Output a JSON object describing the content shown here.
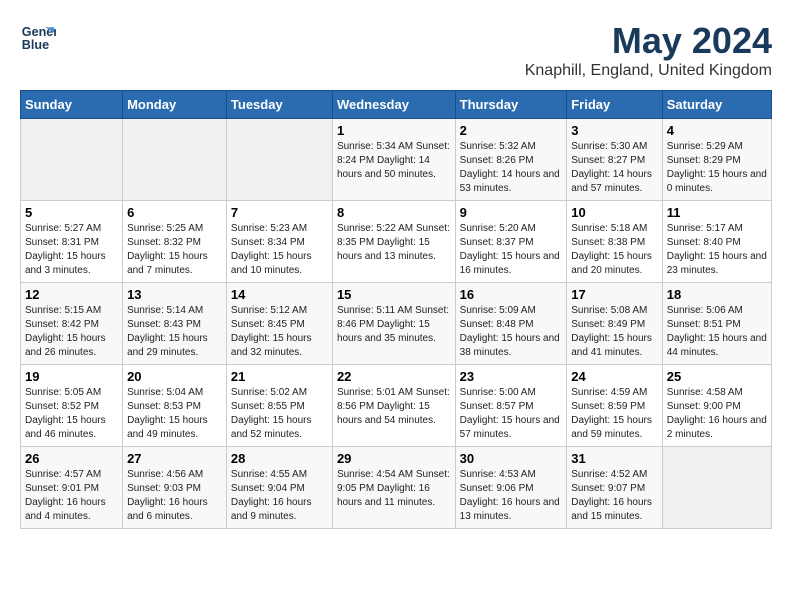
{
  "logo": {
    "line1": "General",
    "line2": "Blue"
  },
  "title": "May 2024",
  "subtitle": "Knaphill, England, United Kingdom",
  "days_header": [
    "Sunday",
    "Monday",
    "Tuesday",
    "Wednesday",
    "Thursday",
    "Friday",
    "Saturday"
  ],
  "weeks": [
    [
      {
        "day": "",
        "info": ""
      },
      {
        "day": "",
        "info": ""
      },
      {
        "day": "",
        "info": ""
      },
      {
        "day": "1",
        "info": "Sunrise: 5:34 AM\nSunset: 8:24 PM\nDaylight: 14 hours\nand 50 minutes."
      },
      {
        "day": "2",
        "info": "Sunrise: 5:32 AM\nSunset: 8:26 PM\nDaylight: 14 hours\nand 53 minutes."
      },
      {
        "day": "3",
        "info": "Sunrise: 5:30 AM\nSunset: 8:27 PM\nDaylight: 14 hours\nand 57 minutes."
      },
      {
        "day": "4",
        "info": "Sunrise: 5:29 AM\nSunset: 8:29 PM\nDaylight: 15 hours\nand 0 minutes."
      }
    ],
    [
      {
        "day": "5",
        "info": "Sunrise: 5:27 AM\nSunset: 8:31 PM\nDaylight: 15 hours\nand 3 minutes."
      },
      {
        "day": "6",
        "info": "Sunrise: 5:25 AM\nSunset: 8:32 PM\nDaylight: 15 hours\nand 7 minutes."
      },
      {
        "day": "7",
        "info": "Sunrise: 5:23 AM\nSunset: 8:34 PM\nDaylight: 15 hours\nand 10 minutes."
      },
      {
        "day": "8",
        "info": "Sunrise: 5:22 AM\nSunset: 8:35 PM\nDaylight: 15 hours\nand 13 minutes."
      },
      {
        "day": "9",
        "info": "Sunrise: 5:20 AM\nSunset: 8:37 PM\nDaylight: 15 hours\nand 16 minutes."
      },
      {
        "day": "10",
        "info": "Sunrise: 5:18 AM\nSunset: 8:38 PM\nDaylight: 15 hours\nand 20 minutes."
      },
      {
        "day": "11",
        "info": "Sunrise: 5:17 AM\nSunset: 8:40 PM\nDaylight: 15 hours\nand 23 minutes."
      }
    ],
    [
      {
        "day": "12",
        "info": "Sunrise: 5:15 AM\nSunset: 8:42 PM\nDaylight: 15 hours\nand 26 minutes."
      },
      {
        "day": "13",
        "info": "Sunrise: 5:14 AM\nSunset: 8:43 PM\nDaylight: 15 hours\nand 29 minutes."
      },
      {
        "day": "14",
        "info": "Sunrise: 5:12 AM\nSunset: 8:45 PM\nDaylight: 15 hours\nand 32 minutes."
      },
      {
        "day": "15",
        "info": "Sunrise: 5:11 AM\nSunset: 8:46 PM\nDaylight: 15 hours\nand 35 minutes."
      },
      {
        "day": "16",
        "info": "Sunrise: 5:09 AM\nSunset: 8:48 PM\nDaylight: 15 hours\nand 38 minutes."
      },
      {
        "day": "17",
        "info": "Sunrise: 5:08 AM\nSunset: 8:49 PM\nDaylight: 15 hours\nand 41 minutes."
      },
      {
        "day": "18",
        "info": "Sunrise: 5:06 AM\nSunset: 8:51 PM\nDaylight: 15 hours\nand 44 minutes."
      }
    ],
    [
      {
        "day": "19",
        "info": "Sunrise: 5:05 AM\nSunset: 8:52 PM\nDaylight: 15 hours\nand 46 minutes."
      },
      {
        "day": "20",
        "info": "Sunrise: 5:04 AM\nSunset: 8:53 PM\nDaylight: 15 hours\nand 49 minutes."
      },
      {
        "day": "21",
        "info": "Sunrise: 5:02 AM\nSunset: 8:55 PM\nDaylight: 15 hours\nand 52 minutes."
      },
      {
        "day": "22",
        "info": "Sunrise: 5:01 AM\nSunset: 8:56 PM\nDaylight: 15 hours\nand 54 minutes."
      },
      {
        "day": "23",
        "info": "Sunrise: 5:00 AM\nSunset: 8:57 PM\nDaylight: 15 hours\nand 57 minutes."
      },
      {
        "day": "24",
        "info": "Sunrise: 4:59 AM\nSunset: 8:59 PM\nDaylight: 15 hours\nand 59 minutes."
      },
      {
        "day": "25",
        "info": "Sunrise: 4:58 AM\nSunset: 9:00 PM\nDaylight: 16 hours\nand 2 minutes."
      }
    ],
    [
      {
        "day": "26",
        "info": "Sunrise: 4:57 AM\nSunset: 9:01 PM\nDaylight: 16 hours\nand 4 minutes."
      },
      {
        "day": "27",
        "info": "Sunrise: 4:56 AM\nSunset: 9:03 PM\nDaylight: 16 hours\nand 6 minutes."
      },
      {
        "day": "28",
        "info": "Sunrise: 4:55 AM\nSunset: 9:04 PM\nDaylight: 16 hours\nand 9 minutes."
      },
      {
        "day": "29",
        "info": "Sunrise: 4:54 AM\nSunset: 9:05 PM\nDaylight: 16 hours\nand 11 minutes."
      },
      {
        "day": "30",
        "info": "Sunrise: 4:53 AM\nSunset: 9:06 PM\nDaylight: 16 hours\nand 13 minutes."
      },
      {
        "day": "31",
        "info": "Sunrise: 4:52 AM\nSunset: 9:07 PM\nDaylight: 16 hours\nand 15 minutes."
      },
      {
        "day": "",
        "info": ""
      }
    ]
  ]
}
